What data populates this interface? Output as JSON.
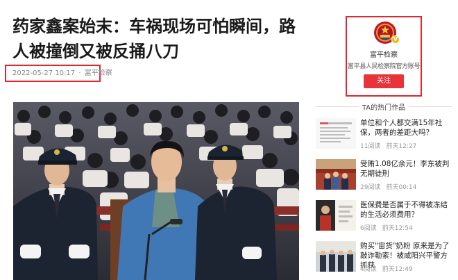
{
  "article": {
    "title": "药家鑫案始末：车祸现场可怕瞬间，路人被撞倒又被反捅八刀",
    "date": "2022-05-27 10:17",
    "separator": "·",
    "source": "富平检察"
  },
  "account": {
    "name": "富平检察",
    "description": "富平县人民检察院官方账号",
    "follow_label": "关注",
    "verified_mark": "V"
  },
  "hot": {
    "section_title": "TA的热门作品",
    "items": [
      {
        "title": "单位和个人都交满15年社保，两者的差距大吗？",
        "reads": "11阅读",
        "time": "前天12:27",
        "thumb": "document"
      },
      {
        "title": "受贿1.08亿余元！李东被判无期徒刑",
        "reads": "29阅读",
        "time": "前天00:14",
        "thumb": "courtroom"
      },
      {
        "title": "医保费是否属于不得被冻结的生活必须费用？",
        "reads": "6阅读",
        "time": "前天12:54",
        "thumb": "portrait"
      },
      {
        "title": "购买\"宙货\"奶粉 原来是为了敲诈勒索！被咸阳兴平警方抓获",
        "reads": "4阅读",
        "time": "前天12:49",
        "thumb": "police"
      }
    ]
  },
  "colors": {
    "highlight": "#e0262e",
    "follow_button": "#e8333a",
    "uniform": "#1c2431",
    "defendant": "#3f78b5"
  }
}
